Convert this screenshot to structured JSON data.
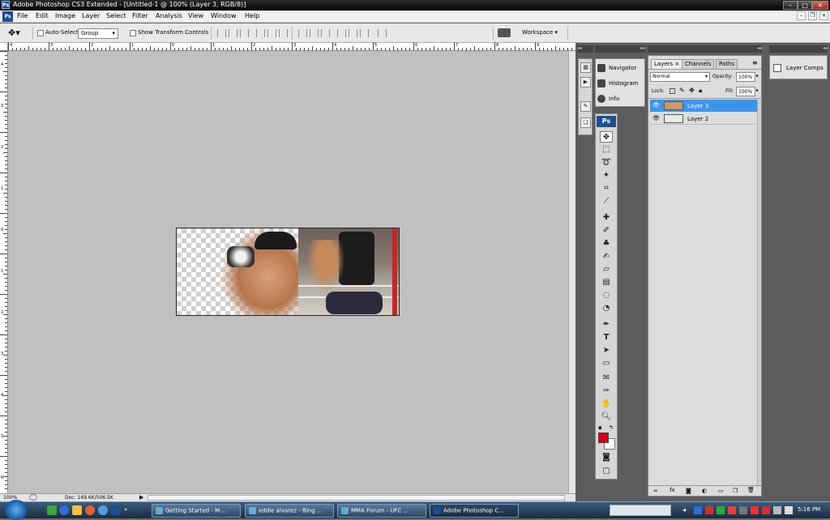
{
  "title_bar": {
    "text": "Adobe Photoshop CS3 Extended - [Untitled-1 @ 100% (Layer 3, RGB/8)]",
    "app_icon": "Ps"
  },
  "menu": [
    "File",
    "Edit",
    "Image",
    "Layer",
    "Select",
    "Filter",
    "Analysis",
    "View",
    "Window",
    "Help"
  ],
  "options": {
    "auto_select": "Auto-Select:",
    "auto_select_value": "Group",
    "transform": "Show Transform Controls",
    "workspace": "Workspace ▾"
  },
  "ruler_top": [
    "4",
    "3",
    "2",
    "1",
    "0",
    "1",
    "2",
    "3",
    "4",
    "5",
    "6",
    "7",
    "8",
    "9"
  ],
  "ruler_left": [
    "4",
    "3",
    "2",
    "1",
    "0",
    "1",
    "2",
    "3",
    "4",
    "5",
    "6"
  ],
  "status": {
    "zoom": "100%",
    "doc": "Doc: 169.6K/506.5K"
  },
  "nav_panel": [
    "Navigator",
    "Histogram",
    "Info"
  ],
  "toolbox_badge": "Ps",
  "layers_panel": {
    "tabs": [
      "Layers ×",
      "Channels",
      "Paths"
    ],
    "blend_mode": "Normal",
    "opacity_label": "Opacity:",
    "opacity_value": "100%",
    "lock_label": "Lock:",
    "fill_label": "Fill:",
    "fill_value": "100%",
    "layers": [
      {
        "name": "Layer 3",
        "selected": true
      },
      {
        "name": "Layer 2",
        "selected": false
      }
    ],
    "footer_icons": [
      "link-icon",
      "fx-icon",
      "mask-icon",
      "adjustment-icon",
      "group-icon",
      "new-layer-icon",
      "trash-icon"
    ]
  },
  "layer_comps": "Layer Comps",
  "taskbar": {
    "tasks": [
      "Getting Started - M...",
      "eddie alvarez - Bing ...",
      "MMA Forum - UFC ...",
      "Adobe Photoshop C..."
    ],
    "time": "5:16 PM"
  },
  "colors": {
    "foreground": "#d0021b",
    "background": "#ffffff",
    "selected_layer": "#3d95ea"
  }
}
